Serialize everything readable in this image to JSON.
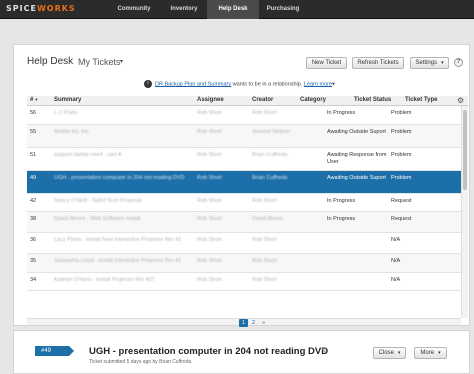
{
  "nav": {
    "logo_prefix": "SPICE",
    "logo_suffix": "WORKS",
    "items": [
      {
        "label": "Community"
      },
      {
        "label": "Inventory"
      },
      {
        "label": "Help Desk"
      },
      {
        "label": "Purchasing"
      }
    ],
    "active": "Help Desk"
  },
  "header": {
    "title": "Help Desk",
    "view": "My Tickets",
    "view_caret": "▾",
    "buttons": {
      "new_ticket": "New Ticket",
      "refresh": "Refresh Tickets",
      "settings": "Settings"
    },
    "help_glyph": "?"
  },
  "notice": {
    "icon": "!",
    "link": "DR Backup Plan and Summary",
    "text": "wants to be in a relationship.",
    "action": "Learn more",
    "action_caret": "▾"
  },
  "table": {
    "columns": {
      "num": "#",
      "summary": "Summary",
      "assignee": "Assignee",
      "creator": "Creator",
      "category": "Category",
      "status": "Ticket Status",
      "type": "Ticket Type"
    },
    "sort_indicator": "▼",
    "rows": [
      {
        "num": "56",
        "summary": "L-2 iPads",
        "assignee": "Rob Short",
        "creator": "Rob Short",
        "category": "",
        "status": "In Progress",
        "type": "Problem"
      },
      {
        "num": "55",
        "summary": "Mobile Kit, Inc.",
        "assignee": "Rob Short",
        "creator": "Jeannie Nelson",
        "category": "",
        "status": "Awaiting Outside Suport",
        "type": "Problem"
      },
      {
        "num": "51",
        "summary": "support laptop need - cart A",
        "assignee": "Rob Short",
        "creator": "Brian Cuffreda",
        "category": "",
        "status": "Awaiting Response from User",
        "type": "Problem"
      },
      {
        "num": "49",
        "summary": "UGH - presentation computer in 204 not reading DVD",
        "assignee": "Rob Short",
        "creator": "Brian Cuffreda",
        "category": "",
        "status": "Awaiting Outside Suport",
        "type": "Problem"
      },
      {
        "num": "42",
        "summary": "Nancy O'Neill - SpEd Tech Proposal",
        "assignee": "Rob Short",
        "creator": "Rob Short",
        "category": "",
        "status": "In Progress",
        "type": "Request"
      },
      {
        "num": "38",
        "summary": "David Moore - Web Software Install",
        "assignee": "Rob Short",
        "creator": "David Moore",
        "category": "",
        "status": "In Progress",
        "type": "Request"
      },
      {
        "num": "36",
        "summary": "Lacy Pinda - Install New Interactive Projector Rm 42",
        "assignee": "Rob Short",
        "creator": "Rob Short",
        "category": "",
        "status": "",
        "type": "N/A"
      },
      {
        "num": "35",
        "summary": "Samantha Lloyd - Install Interactive Projector Rm 41",
        "assignee": "Rob Short",
        "creator": "Rob Short",
        "category": "",
        "status": "",
        "type": "N/A"
      },
      {
        "num": "34",
        "summary": "Katelyn O'Hara - Install Projector Rm 407",
        "assignee": "Rob Short",
        "creator": "Rob Short",
        "category": "",
        "status": "",
        "type": "N/A"
      }
    ],
    "selected_index": 3
  },
  "pagination": {
    "current": "1",
    "next": "2",
    "next_arrow": "»"
  },
  "detail": {
    "badge": "#49",
    "title": "UGH - presentation computer in 204 not reading DVD",
    "meta": "Ticket submitted 5 days ago by Brian Cuffreda",
    "close_label": "Close",
    "more_label": "More",
    "caret": "▾"
  }
}
